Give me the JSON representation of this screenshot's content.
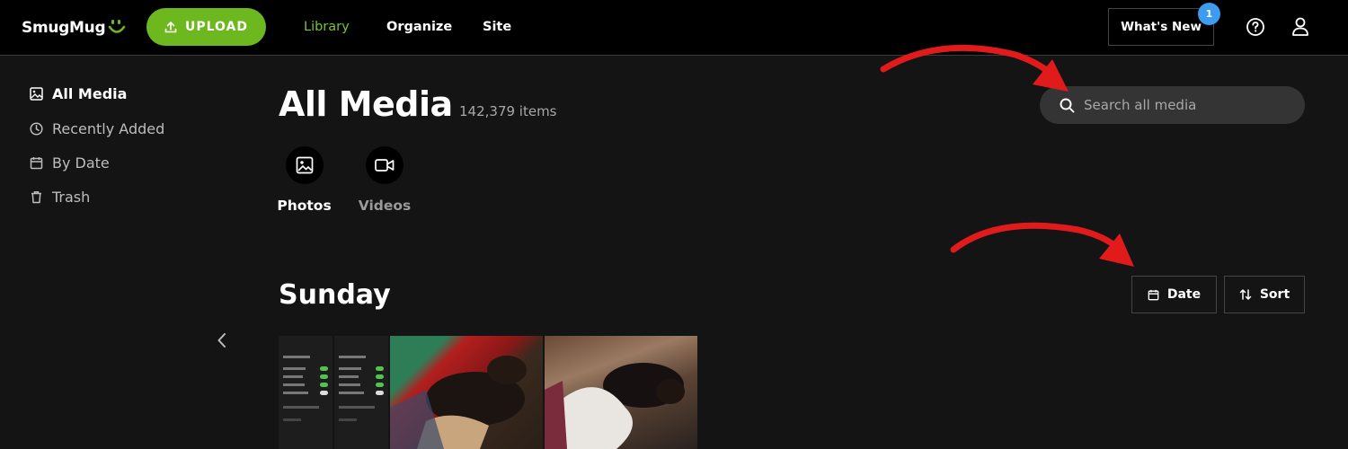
{
  "header": {
    "logo_text": "SmugMug",
    "upload_label": "UPLOAD",
    "nav": [
      {
        "label": "Library",
        "active": true
      },
      {
        "label": "Organize",
        "active": false
      },
      {
        "label": "Site",
        "active": false
      }
    ],
    "whats_new_label": "What's New",
    "whats_new_badge": "1",
    "icons": [
      "upload-icon",
      "help-icon",
      "user-icon"
    ]
  },
  "sidebar": {
    "items": [
      {
        "label": "All Media",
        "icon": "image-icon",
        "active": true
      },
      {
        "label": "Recently Added",
        "icon": "clock-icon",
        "active": false
      },
      {
        "label": "By Date",
        "icon": "calendar-icon",
        "active": false
      },
      {
        "label": "Trash",
        "icon": "trash-icon",
        "active": false
      }
    ]
  },
  "main": {
    "title": "All Media",
    "item_count": "142,379 items",
    "search_placeholder": "Search all media",
    "type_tabs": [
      {
        "label": "Photos",
        "icon": "photo-icon",
        "active": true
      },
      {
        "label": "Videos",
        "icon": "video-icon",
        "active": false
      }
    ],
    "section_title": "Sunday",
    "date_button_label": "Date",
    "sort_button_label": "Sort"
  },
  "colors": {
    "accent_green": "#6db81f",
    "nav_active": "#7ac52b",
    "badge_blue": "#3d9bf0",
    "annotation_red": "#e11b1b",
    "background": "#141414"
  }
}
